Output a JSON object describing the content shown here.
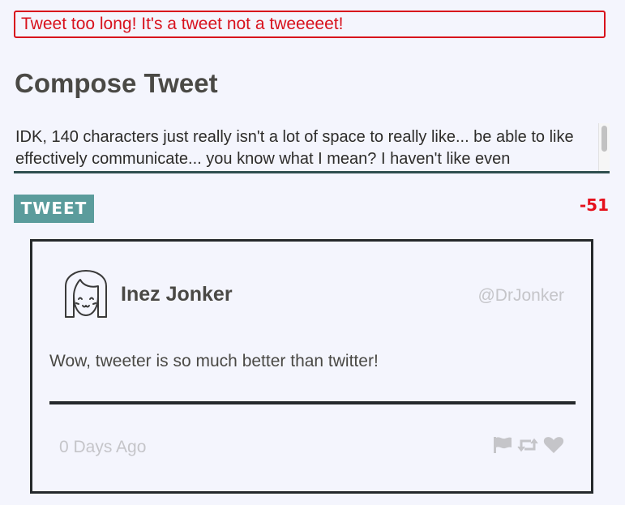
{
  "error": {
    "message": "Tweet too long! It's a tweet not a tweeeeet!"
  },
  "compose": {
    "title": "Compose Tweet",
    "draft_text": "IDK, 140 characters just really isn't a lot of space to really like... be able to like effectively communicate... you know what I mean? I haven't like even",
    "tweet_button_label": "TWEET",
    "char_counter": "-51"
  },
  "tweet": {
    "user_name": "Inez Jonker",
    "handle": "@DrJonker",
    "text": "Wow, tweeter is so much better than twitter!",
    "time_ago": "0 Days Ago",
    "icons": [
      "flag-icon",
      "retweet-icon",
      "heart-icon"
    ]
  },
  "colors": {
    "error": "#d8111c",
    "accent": "#5b9c9c",
    "counter_negative": "#e5101c",
    "muted": "#c5c5c9",
    "text": "#4a4945",
    "border": "#25292b"
  }
}
